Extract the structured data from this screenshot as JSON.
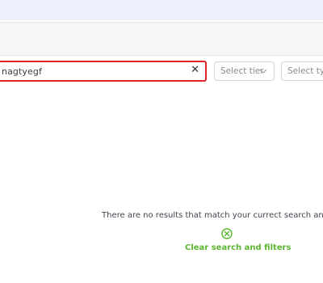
{
  "search": {
    "value": "nagtyegf",
    "clear_glyph": "✕"
  },
  "filters": {
    "tier_placeholder": "Select tier",
    "type_placeholder": "Select type"
  },
  "empty_state": {
    "message": "There are no results that match your currect search and applie",
    "clear_label": "Clear search and filters",
    "icon": "clear-circle-icon"
  },
  "colors": {
    "top_band": "#eef0fb",
    "search_border": "#e02424",
    "accent_green": "#5ab52f"
  }
}
